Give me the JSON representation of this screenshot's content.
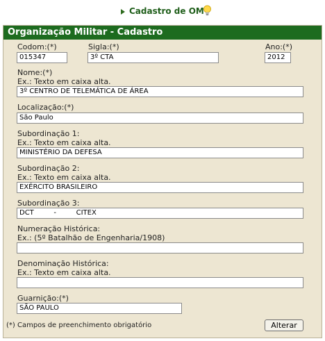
{
  "page_title": "Cadastro de OM",
  "panel_title": "Organização Militar - Cadastro",
  "fields": {
    "codom": {
      "label": "Codom:(*)",
      "value": "015347"
    },
    "sigla": {
      "label": "Sigla:(*)",
      "value": "3º CTA"
    },
    "ano": {
      "label": "Ano:(*)",
      "value": "2012"
    },
    "nome": {
      "label": "Nome:(*)",
      "hint": "Ex.: Texto em caixa alta.",
      "value": "3º CENTRO DE TELEMÁTICA DE ÁREA"
    },
    "localizacao": {
      "label": "Localização:(*)",
      "value": "São Paulo"
    },
    "subordinacao1": {
      "label": "Subordinação 1:",
      "hint": "Ex.: Texto em caixa alta.",
      "value": "MINISTÉRIO DA DEFESA"
    },
    "subordinacao2": {
      "label": "Subordinação 2:",
      "hint": "Ex.: Texto em caixa alta.",
      "value": "EXÉRCITO BRASILEIRO"
    },
    "subordinacao3": {
      "label": "Subordinação 3:",
      "value": "DCT         -         CITEX"
    },
    "numeracao": {
      "label": "Numeração Histórica:",
      "hint": "Ex.: (5º Batalhão de Engenharia/1908)",
      "value": ""
    },
    "denominacao": {
      "label": "Denominação Histórica:",
      "hint": "Ex.: Texto em caixa alta.",
      "value": ""
    },
    "guarnicao": {
      "label": "Guarnição:(*)",
      "value": "SÃO PAULO"
    }
  },
  "footer_note": "(*) Campos de preenchimento obrigatório",
  "submit_label": "Alterar",
  "colors": {
    "header_bg": "#1d6b1f",
    "panel_bg": "#ede6d2"
  }
}
